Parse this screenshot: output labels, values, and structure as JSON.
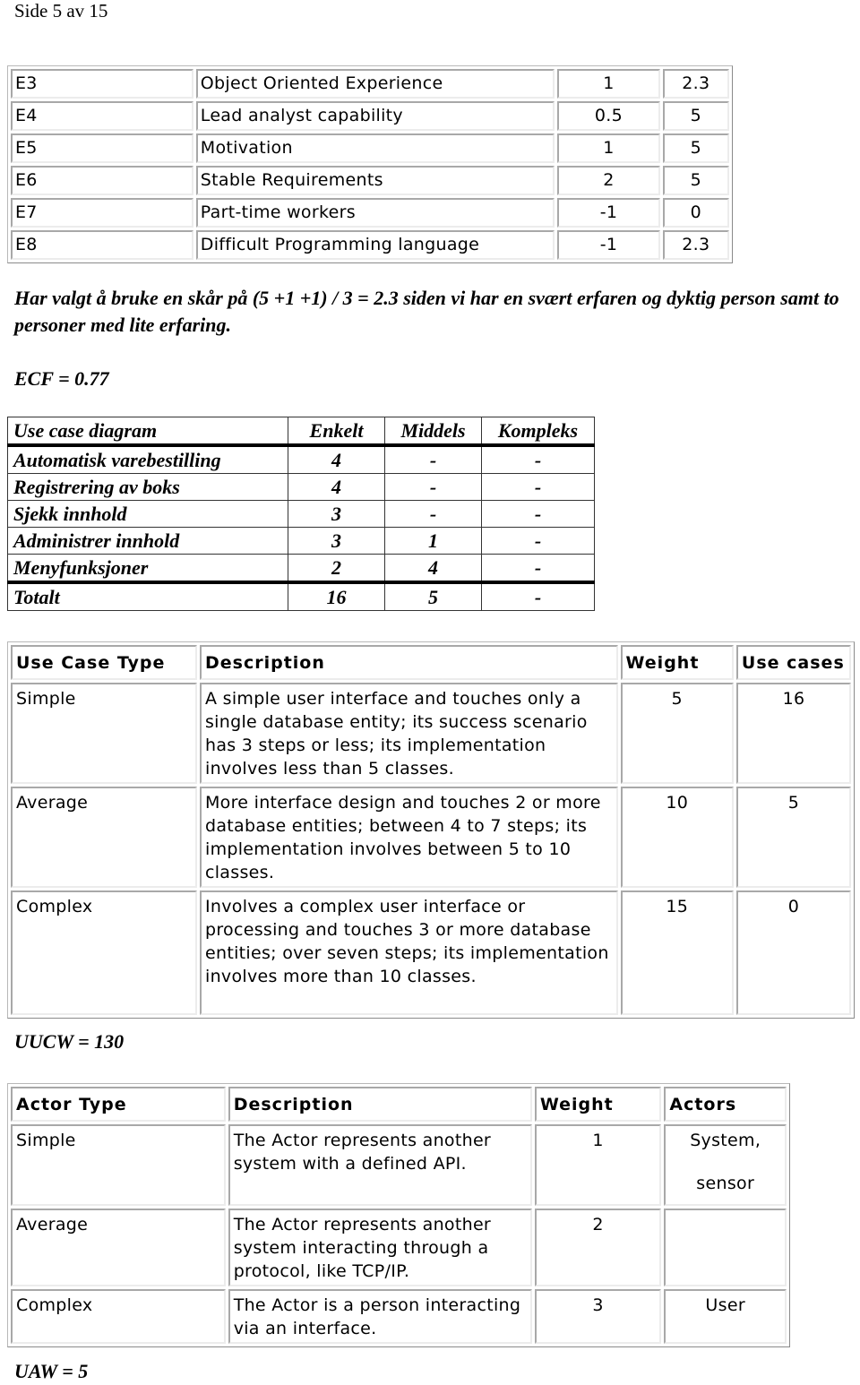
{
  "page_header": "Side 5 av 15",
  "effort_factors": {
    "rows": [
      {
        "id": "E3",
        "description": "Object Oriented Experience",
        "weight": "1",
        "rating": "2.3"
      },
      {
        "id": "E4",
        "description": "Lead analyst capability",
        "weight": "0.5",
        "rating": "5"
      },
      {
        "id": "E5",
        "description": "Motivation",
        "weight": "1",
        "rating": "5"
      },
      {
        "id": "E6",
        "description": "Stable Requirements",
        "weight": "2",
        "rating": "5"
      },
      {
        "id": "E7",
        "description": "Part-time workers",
        "weight": "-1",
        "rating": "0"
      },
      {
        "id": "E8",
        "description": "Difficult Programming language",
        "weight": "-1",
        "rating": "2.3"
      }
    ]
  },
  "note": "Har valgt å bruke en skår på (5 +1 +1) / 3 = 2.3 siden vi har en svært erfaren og dyktig person samt to personer med lite erfaring.",
  "ecf": "ECF = 0.77",
  "use_case_diagram": {
    "headers": [
      "Use case diagram",
      "Enkelt",
      "Middels",
      "Kompleks"
    ],
    "rows": [
      [
        "Automatisk varebestilling",
        "4",
        "-",
        "-"
      ],
      [
        "Registrering av boks",
        "4",
        "-",
        "-"
      ],
      [
        "Sjekk innhold",
        "3",
        "-",
        "-"
      ],
      [
        "Administrer innhold",
        "3",
        "1",
        "-"
      ],
      [
        "Menyfunksjoner",
        "2",
        "4",
        "-"
      ]
    ],
    "total": [
      "Totalt",
      "16",
      "5",
      "-"
    ]
  },
  "use_case_types": {
    "headers": [
      "Use Case Type",
      "Description",
      "Weight",
      "Use cases"
    ],
    "rows": [
      {
        "type": "Simple",
        "description": "A simple user interface and touches only a single database entity; its success scenario has 3 steps or less; its implementation involves less than 5 classes.",
        "weight": "5",
        "count": "16"
      },
      {
        "type": "Average",
        "description": "More interface design and touches 2 or more database entities; between 4 to 7 steps; its implementation involves between 5 to 10 classes.",
        "weight": "10",
        "count": "5"
      },
      {
        "type": "Complex",
        "description": "Involves a complex user interface or processing and touches 3 or more database entities; over seven steps; its implementation involves more than 10 classes.",
        "weight": "15",
        "count": "0"
      }
    ]
  },
  "uucw": "UUCW = 130",
  "actor_types": {
    "headers": [
      "Actor Type",
      "Description",
      "Weight",
      "Actors"
    ],
    "rows": [
      {
        "type": "Simple",
        "description": "The Actor represents another system with a defined API.",
        "weight": "1",
        "actors": [
          "System,",
          "sensor"
        ]
      },
      {
        "type": "Average",
        "description": "The Actor represents another system interacting through a protocol, like TCP/IP.",
        "weight": "2",
        "actors": []
      },
      {
        "type": "Complex",
        "description": "The Actor is a person interacting via an interface.",
        "weight": "3",
        "actors": [
          "User"
        ]
      }
    ]
  },
  "uaw": "UAW = 5"
}
